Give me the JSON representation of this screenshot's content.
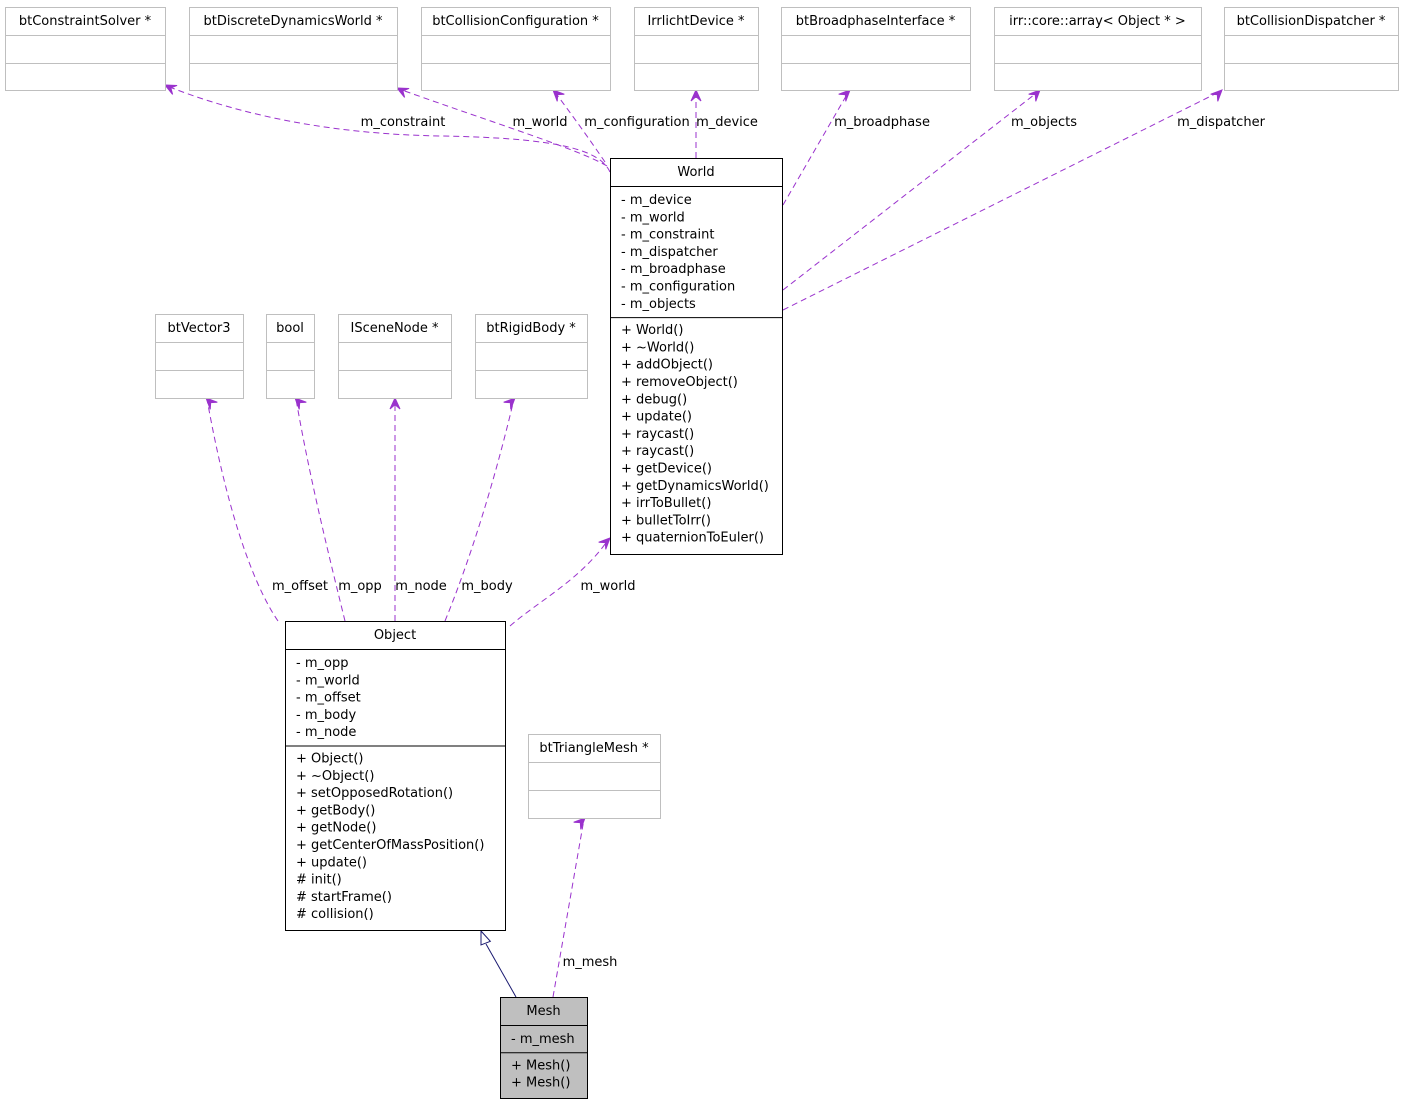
{
  "colors": {
    "dependency": "#9a32cd",
    "inheritance": "#191970",
    "focus_fill": "#bfbfbf",
    "external_border": "#bfbfbf"
  },
  "classes": {
    "btConstraintSolver": {
      "name": "btConstraintSolver *",
      "attributes": [],
      "methods": [],
      "external": true
    },
    "btDiscreteDynamicsWorld": {
      "name": "btDiscreteDynamicsWorld *",
      "attributes": [],
      "methods": [],
      "external": true
    },
    "btCollisionConfiguration": {
      "name": "btCollisionConfiguration *",
      "attributes": [],
      "methods": [],
      "external": true
    },
    "IrrlichtDevice": {
      "name": "IrrlichtDevice *",
      "attributes": [],
      "methods": [],
      "external": true
    },
    "btBroadphaseInterface": {
      "name": "btBroadphaseInterface *",
      "attributes": [],
      "methods": [],
      "external": true
    },
    "objectArray": {
      "name": "irr::core::array< Object * >",
      "attributes": [],
      "methods": [],
      "external": true
    },
    "btCollisionDispatcher": {
      "name": "btCollisionDispatcher *",
      "attributes": [],
      "methods": [],
      "external": true
    },
    "World": {
      "name": "World",
      "attributes": [
        "- m_device",
        "- m_world",
        "- m_constraint",
        "- m_dispatcher",
        "- m_broadphase",
        "- m_configuration",
        "- m_objects"
      ],
      "methods": [
        "+ World()",
        "+ ~World()",
        "+ addObject()",
        "+ removeObject()",
        "+ debug()",
        "+ update()",
        "+ raycast()",
        "+ raycast()",
        "+ getDevice()",
        "+ getDynamicsWorld()",
        "+ irrToBullet()",
        "+ bulletToIrr()",
        "+ quaternionToEuler()"
      ]
    },
    "btVector3": {
      "name": "btVector3",
      "attributes": [],
      "methods": [],
      "external": true
    },
    "bool": {
      "name": "bool",
      "attributes": [],
      "methods": [],
      "external": true
    },
    "ISceneNode": {
      "name": "ISceneNode *",
      "attributes": [],
      "methods": [],
      "external": true
    },
    "btRigidBody": {
      "name": "btRigidBody *",
      "attributes": [],
      "methods": [],
      "external": true
    },
    "Object": {
      "name": "Object",
      "attributes": [
        "- m_opp",
        "- m_world",
        "- m_offset",
        "- m_body",
        "- m_node"
      ],
      "methods": [
        "+ Object()",
        "+ ~Object()",
        "+ setOpposedRotation()",
        "+ getBody()",
        "+ getNode()",
        "+ getCenterOfMassPosition()",
        "+ update()",
        "# init()",
        "# startFrame()",
        "# collision()"
      ]
    },
    "btTriangleMesh": {
      "name": "btTriangleMesh *",
      "attributes": [],
      "methods": [],
      "external": true
    },
    "Mesh": {
      "name": "Mesh",
      "attributes": [
        "- m_mesh"
      ],
      "methods": [
        "+ Mesh()",
        "+ Mesh()"
      ],
      "focus": true
    }
  },
  "edges": [
    {
      "from": "World",
      "to": "btConstraintSolver",
      "label": "m_constraint",
      "kind": "usage"
    },
    {
      "from": "World",
      "to": "btDiscreteDynamicsWorld",
      "label": "m_world",
      "kind": "usage"
    },
    {
      "from": "World",
      "to": "btCollisionConfiguration",
      "label": "m_configuration",
      "kind": "usage"
    },
    {
      "from": "World",
      "to": "IrrlichtDevice",
      "label": "m_device",
      "kind": "usage"
    },
    {
      "from": "World",
      "to": "btBroadphaseInterface",
      "label": "m_broadphase",
      "kind": "usage"
    },
    {
      "from": "World",
      "to": "objectArray",
      "label": "m_objects",
      "kind": "usage"
    },
    {
      "from": "World",
      "to": "btCollisionDispatcher",
      "label": "m_dispatcher",
      "kind": "usage"
    },
    {
      "from": "Object",
      "to": "btVector3",
      "label": "m_offset",
      "kind": "usage"
    },
    {
      "from": "Object",
      "to": "bool",
      "label": "m_opp",
      "kind": "usage"
    },
    {
      "from": "Object",
      "to": "ISceneNode",
      "label": "m_node",
      "kind": "usage"
    },
    {
      "from": "Object",
      "to": "btRigidBody",
      "label": "m_body",
      "kind": "usage"
    },
    {
      "from": "Object",
      "to": "World",
      "label": "m_world",
      "kind": "usage"
    },
    {
      "from": "Mesh",
      "to": "btTriangleMesh",
      "label": "m_mesh",
      "kind": "usage"
    },
    {
      "from": "Mesh",
      "to": "Object",
      "label": "",
      "kind": "inheritance"
    }
  ]
}
